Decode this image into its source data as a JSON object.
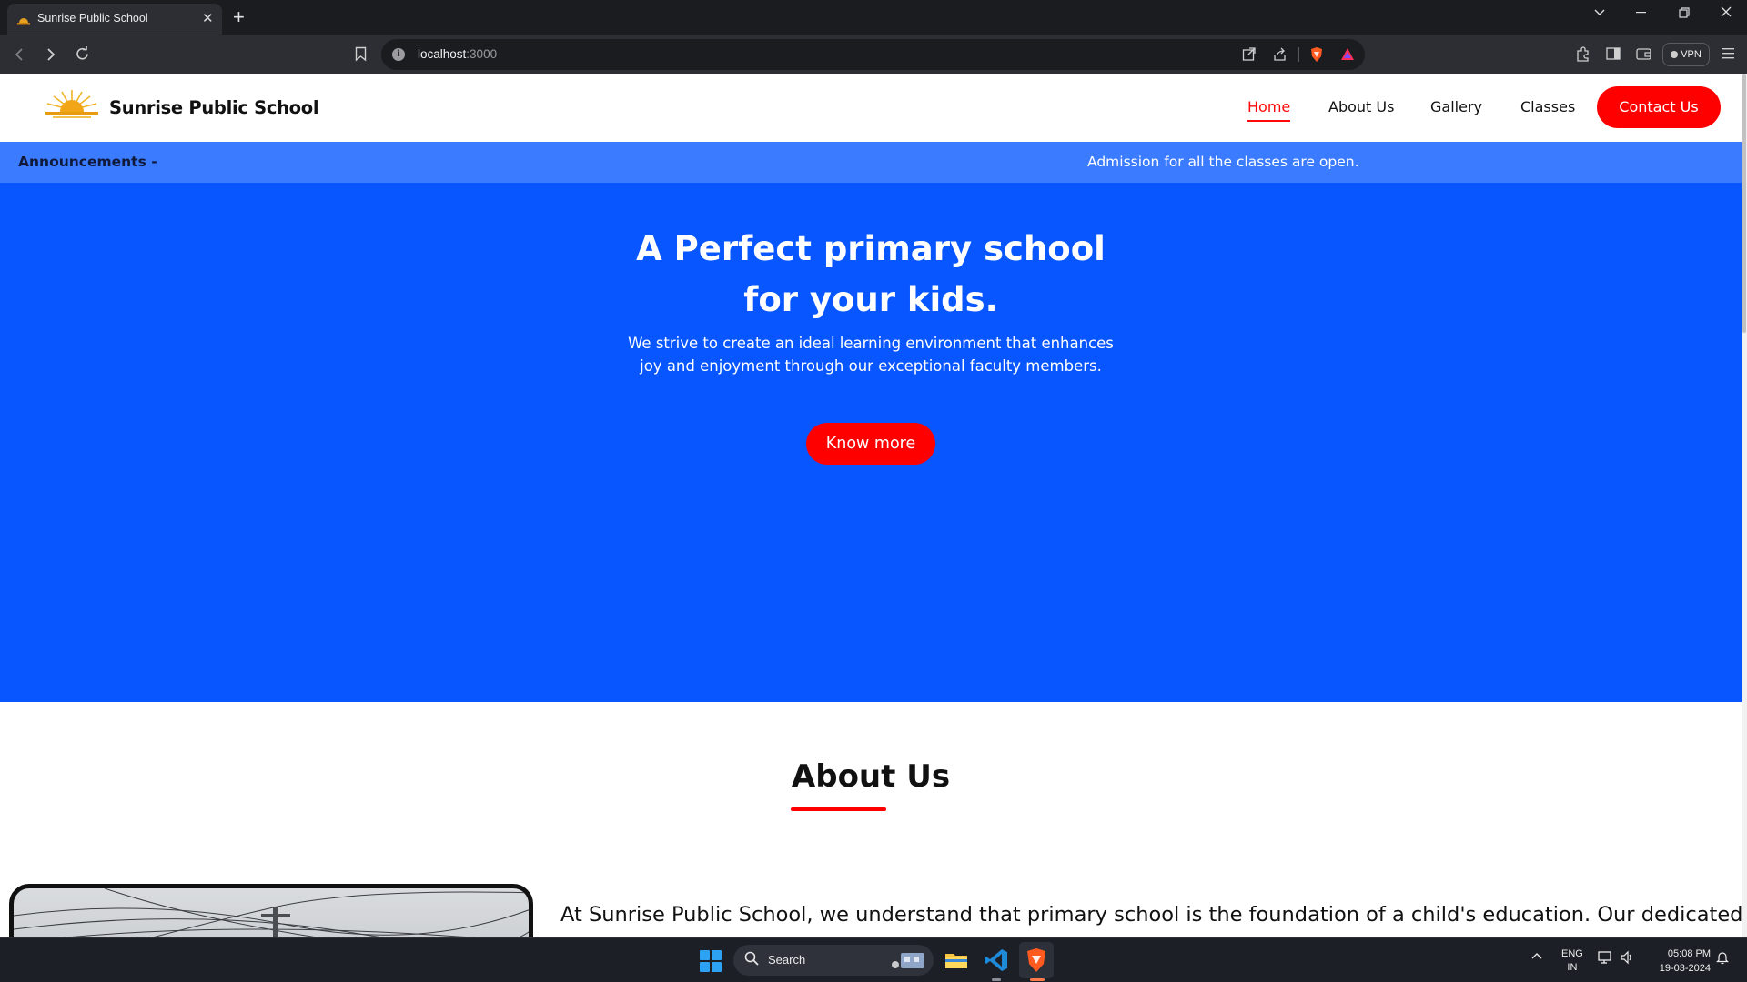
{
  "browser": {
    "tab_title": "Sunrise Public School",
    "tab_close": "✕",
    "new_tab": "+",
    "url_host": "localhost",
    "url_port": ":3000",
    "vpn_label": "VPN",
    "icons": [
      "back-icon",
      "forward-icon",
      "reload-icon",
      "bookmark-icon",
      "site-info-icon",
      "open-external-icon",
      "share-icon",
      "brave-shields-icon",
      "brave-rewards-icon",
      "extensions-icon",
      "sidebar-icon",
      "wallet-icon",
      "menu-icon"
    ]
  },
  "site": {
    "brand": "Sunrise Public School",
    "nav": {
      "home": "Home",
      "about": "About Us",
      "gallery": "Gallery",
      "classes": "Classes",
      "contact": "Contact Us"
    },
    "announcements": {
      "label": "Announcements -",
      "text": "Admission for all the classes are open."
    },
    "hero": {
      "title_line1": "A Perfect primary school",
      "title_line2": "for your kids.",
      "subtitle_line1": "We strive to create an ideal learning environment that enhances",
      "subtitle_line2": "joy and enjoyment through our exceptional faculty members.",
      "cta": "Know more"
    },
    "about": {
      "title": "About Us",
      "text": "At Sunrise Public School, we understand that primary school is the foundation of a child's education. Our dedicated"
    },
    "colors": {
      "accent_red": "#ff0000",
      "hero_blue": "#0756ff",
      "announcement_blue": "#3a7bff"
    }
  },
  "taskbar": {
    "search_label": "Search",
    "lang_line1": "ENG",
    "lang_line2": "IN",
    "time": "05:08 PM",
    "date": "19-03-2024"
  }
}
